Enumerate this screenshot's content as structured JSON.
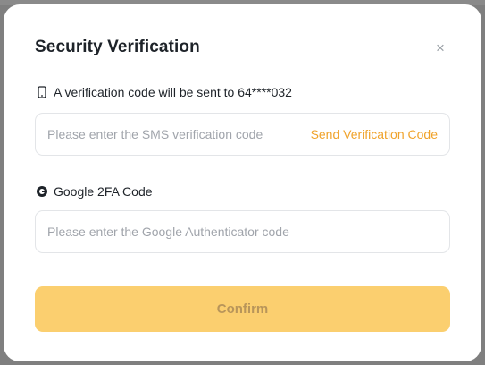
{
  "modal": {
    "title": "Security Verification",
    "close_symbol": "×"
  },
  "sms": {
    "icon": "phone-icon",
    "label": "A verification code will be sent to 64****032",
    "placeholder": "Please enter the SMS verification code",
    "value": "",
    "send_code_label": "Send Verification Code"
  },
  "google": {
    "icon": "google-icon",
    "label": "Google 2FA Code",
    "placeholder": "Please enter the Google Authenticator code",
    "value": ""
  },
  "confirm": {
    "label": "Confirm"
  },
  "colors": {
    "accent": "#f0a32b",
    "confirm_bg": "#fbcf6f",
    "overlay": "#7f7f7f"
  }
}
